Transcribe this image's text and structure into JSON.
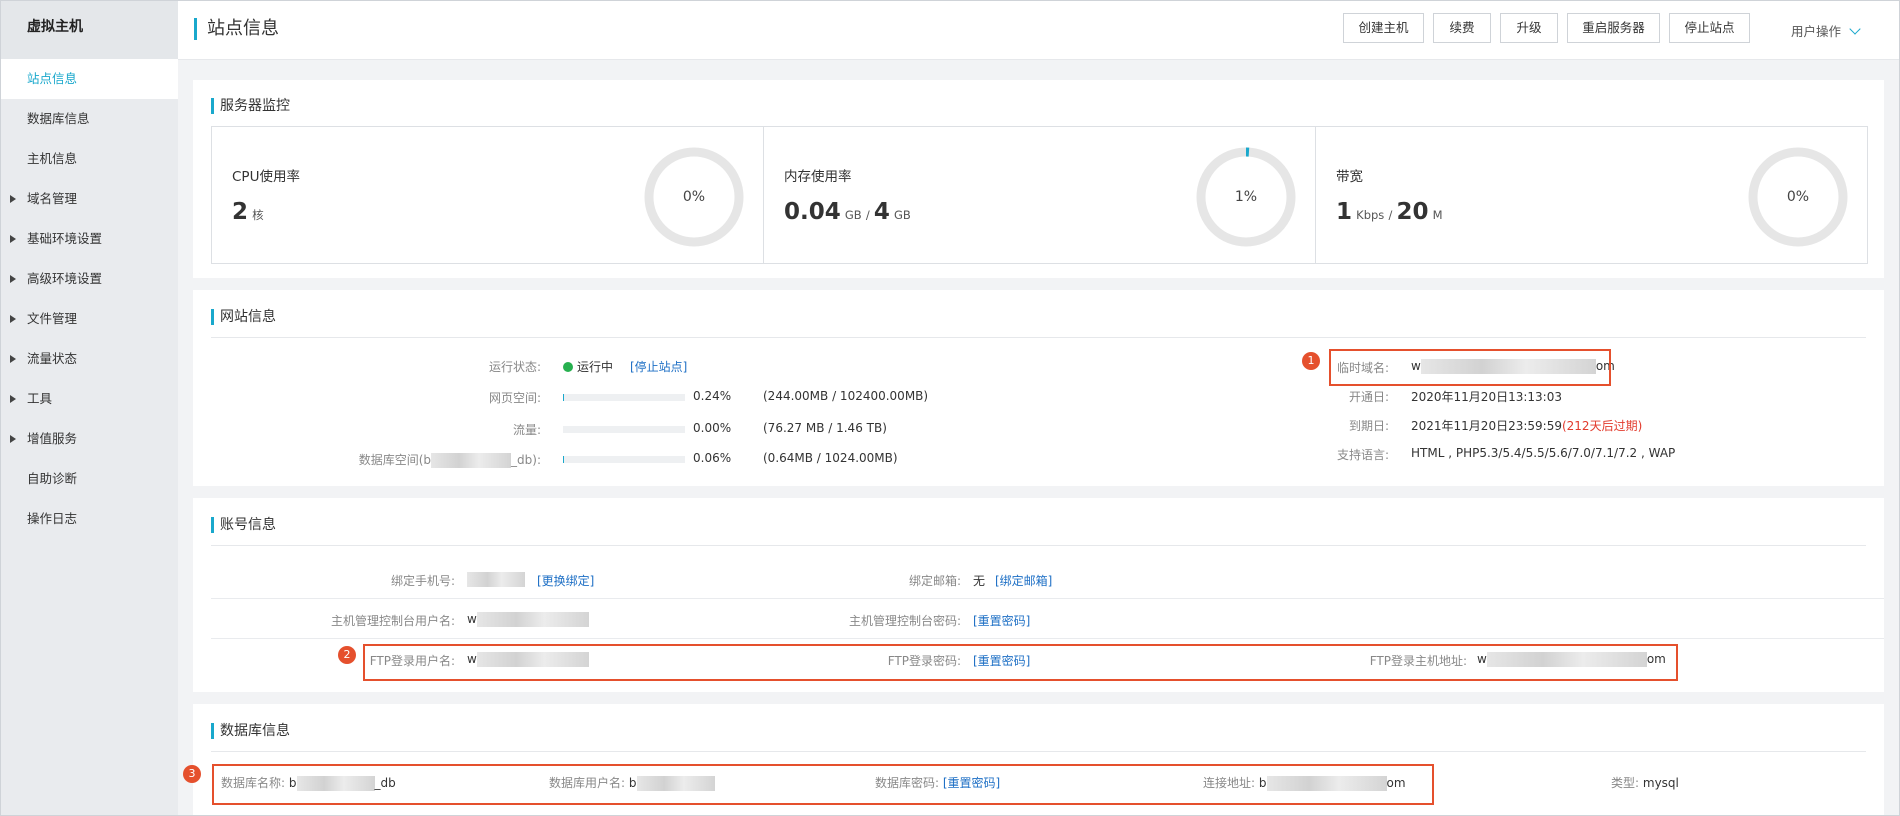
{
  "sidebar": {
    "title": "虚拟主机",
    "items": [
      {
        "label": "站点信息",
        "active": true,
        "expandable": false
      },
      {
        "label": "数据库信息",
        "expandable": false
      },
      {
        "label": "主机信息",
        "expandable": false
      },
      {
        "label": "域名管理",
        "expandable": true
      },
      {
        "label": "基础环境设置",
        "expandable": true
      },
      {
        "label": "高级环境设置",
        "expandable": true
      },
      {
        "label": "文件管理",
        "expandable": true
      },
      {
        "label": "流量状态",
        "expandable": true
      },
      {
        "label": "工具",
        "expandable": true
      },
      {
        "label": "增值服务",
        "expandable": true
      },
      {
        "label": "自助诊断",
        "expandable": false
      },
      {
        "label": "操作日志",
        "expandable": false
      }
    ]
  },
  "header": {
    "title": "站点信息",
    "buttons": {
      "create": "创建主机",
      "renew": "续费",
      "upgrade": "升级",
      "restart": "重启服务器",
      "stop": "停止站点"
    },
    "user_ops": "用户操作"
  },
  "monitor": {
    "title": "服务器监控",
    "cpu": {
      "label": "CPU使用率",
      "value": "2",
      "unit": "核",
      "percent_text": "0%",
      "percent": 0
    },
    "memory": {
      "label": "内存使用率",
      "used": "0.04",
      "used_unit": "GB",
      "sep": "/",
      "total": "4",
      "total_unit": "GB",
      "percent_text": "1%",
      "percent": 1
    },
    "bandwidth": {
      "label": "带宽",
      "used": "1",
      "used_unit": "Kbps",
      "sep": "/",
      "total": "20",
      "total_unit": "M",
      "percent_text": "0%",
      "percent": 0
    }
  },
  "site": {
    "title": "网站信息",
    "status_label": "运行状态:",
    "status": "运行中",
    "stop_link": "[停止站点]",
    "web_space_label": "网页空间:",
    "web_space_pct": "0.24%",
    "web_space_pct_value": 0.24,
    "web_space_detail": "(244.00MB / 102400.00MB)",
    "traffic_label": "流量:",
    "traffic_pct": "0.00%",
    "traffic_pct_value": 0,
    "traffic_detail": "(76.27 MB / 1.46 TB)",
    "db_space_label_pre": "数据库空间(b",
    "db_space_label_post": "_db):",
    "db_space_pct": "0.06%",
    "db_space_pct_value": 0.06,
    "db_space_detail": "(0.64MB / 1024.00MB)",
    "temp_domain_label": "临时域名:",
    "temp_domain_pre": "w",
    "temp_domain_post": "om",
    "open_date_label": "开通日:",
    "open_date": "2020年11月20日13:13:03",
    "expire_label": "到期日:",
    "expire_date": "2021年11月20日23:59:59",
    "expire_note": "(212天后过期)",
    "expire_close": ")",
    "lang_label": "支持语言:",
    "languages": "HTML , PHP5.3/5.4/5.5/5.6/7.0/7.1/7.2 , WAP"
  },
  "account": {
    "title": "账号信息",
    "phone_label": "绑定手机号:",
    "change_bind": "[更换绑定]",
    "email_label": "绑定邮箱:",
    "email_value": "无",
    "bind_email": "[绑定邮箱]",
    "console_user_label": "主机管理控制台用户名:",
    "console_user_pre": "w",
    "console_pwd_label": "主机管理控制台密码:",
    "reset_pwd": "[重置密码]",
    "ftp_user_label": "FTP登录用户名:",
    "ftp_user_pre": "w",
    "ftp_pwd_label": "FTP登录密码:",
    "ftp_host_label": "FTP登录主机地址:",
    "ftp_host_pre": "w",
    "ftp_host_post": "om"
  },
  "database": {
    "title": "数据库信息",
    "name_label": "数据库名称:",
    "name_pre": "b",
    "name_post": "_db",
    "user_label": "数据库用户名:",
    "user_pre": "b",
    "pwd_label": "数据库密码:",
    "reset_pwd": "[重置密码]",
    "host_label": "连接地址:",
    "host_pre": "b",
    "host_post": "om",
    "type_label": "类型:",
    "type_value": "mysql"
  },
  "annotations": [
    "1",
    "2",
    "3"
  ],
  "colors": {
    "accent": "#19a8cc",
    "link": "#1d6fc5",
    "highlight": "#e5502d",
    "running": "#27b04f",
    "warning": "#e23b2d"
  }
}
